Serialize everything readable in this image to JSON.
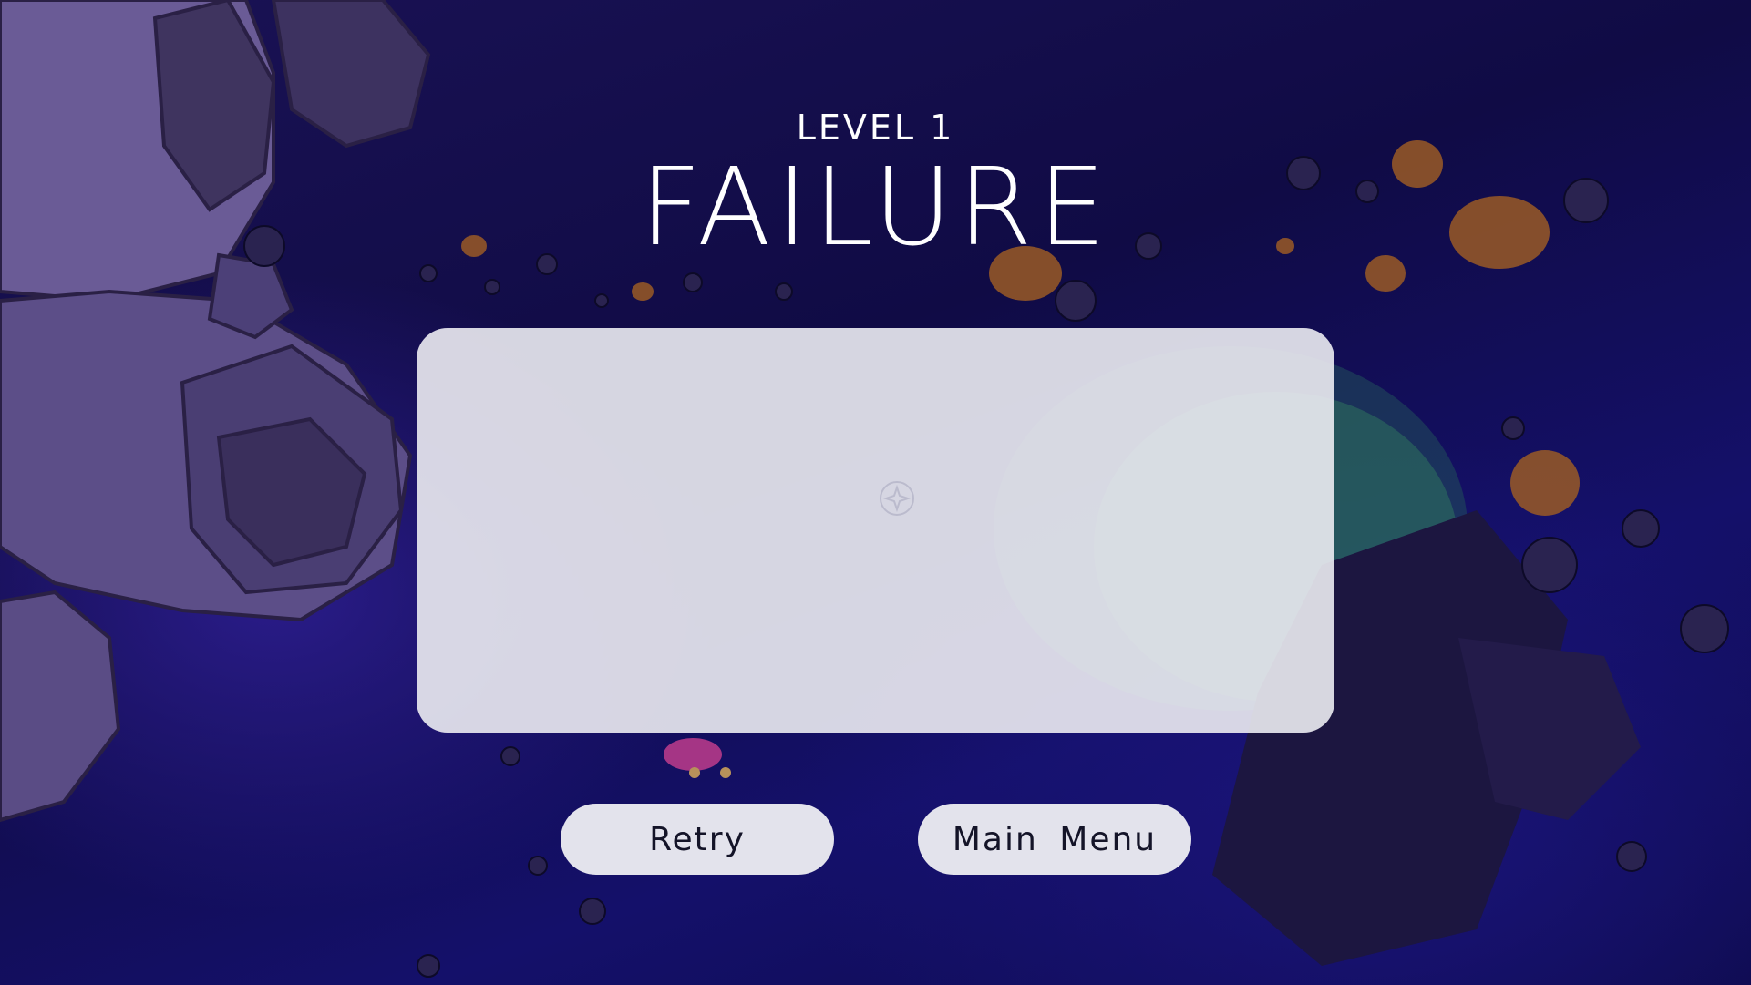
{
  "screen": {
    "level_label": "LEVEL 1",
    "result_title": "FAILURE"
  },
  "buttons": {
    "retry_label": "Retry",
    "main_menu_label": "Main Menu"
  },
  "colors": {
    "background": "#100b45",
    "panel": "#ececf2",
    "button": "#e3e3ec",
    "text_light": "#ffffff",
    "text_dark": "#141428"
  }
}
